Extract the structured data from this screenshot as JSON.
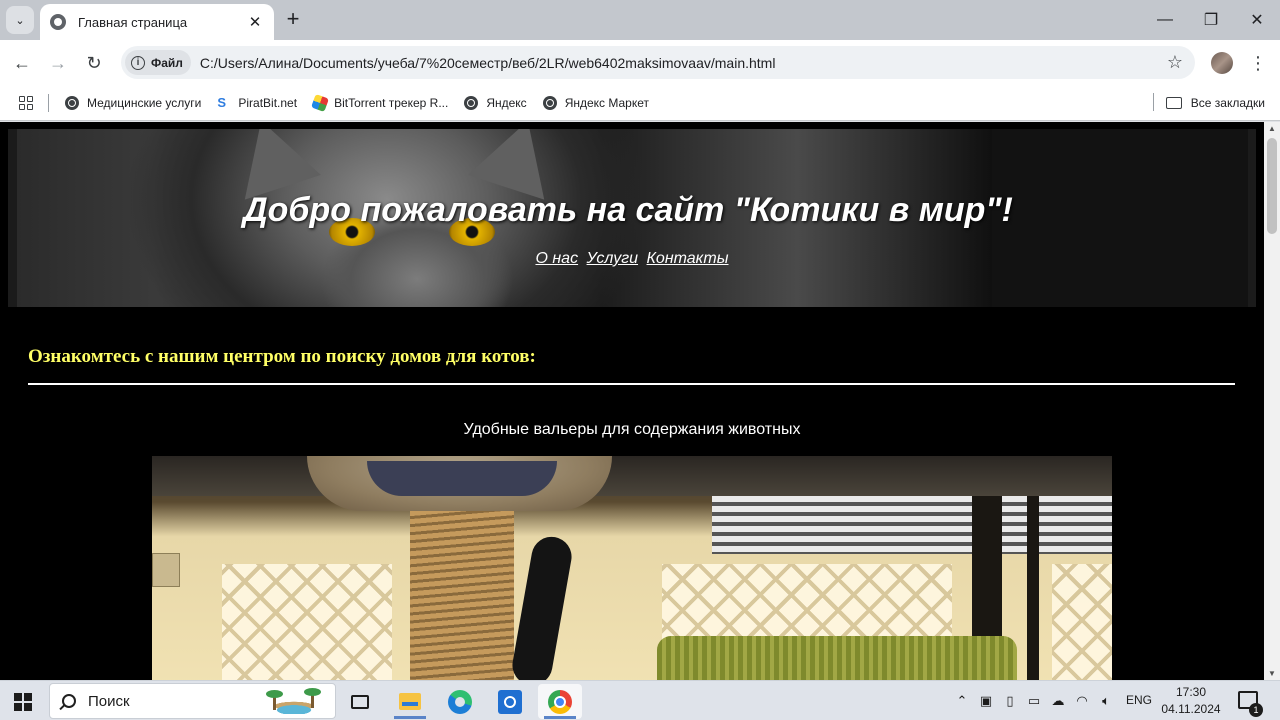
{
  "browser": {
    "tab_title": "Главная страница",
    "tab_close": "✕",
    "new_tab": "+",
    "window_controls": {
      "minimize": "—",
      "restore": "❐",
      "close": "✕"
    },
    "chip_label": "Файл",
    "url": "C:/Users/Алина/Documents/учеба/7%20семестр/веб/2LR/web6402maksimovaav/main.html",
    "nav": {
      "back": "←",
      "forward": "→",
      "reload": "↻",
      "star": "☆",
      "menu": "⋮"
    },
    "bookmarks": [
      {
        "label": "Медицинские услуги",
        "icon": "globe-icon"
      },
      {
        "label": "PiratBit.net",
        "icon": "piratbit-icon"
      },
      {
        "label": "BitTorrent трекер R...",
        "icon": "bittorrent-icon"
      },
      {
        "label": "Яндекс",
        "icon": "globe-icon"
      },
      {
        "label": "Яндекс Маркет",
        "icon": "globe-icon"
      }
    ],
    "all_bookmarks": "Все закладки"
  },
  "page": {
    "hero_title": "Добро пожаловать на сайт \"Котики в мир\"!",
    "nav_links": [
      "О нас",
      "Услуги",
      "Контакты"
    ],
    "section_title": "Ознакомтесь с нашим центром по поиску домов для котов:",
    "caption": "Удобные вальеры для содержания животных"
  },
  "taskbar": {
    "search_label": "Поиск",
    "lang": "ENG",
    "time": "17:30",
    "date": "04.11.2024",
    "notification_count": "1",
    "tray_icons": [
      "chevron-up-icon",
      "network-device-icon",
      "phone-link-icon",
      "battery-icon",
      "cloud-icon",
      "wifi-icon",
      "volume-icon"
    ]
  },
  "colors": {
    "page_bg": "#000000",
    "section_title": "#ffff66",
    "text": "#ffffff"
  }
}
